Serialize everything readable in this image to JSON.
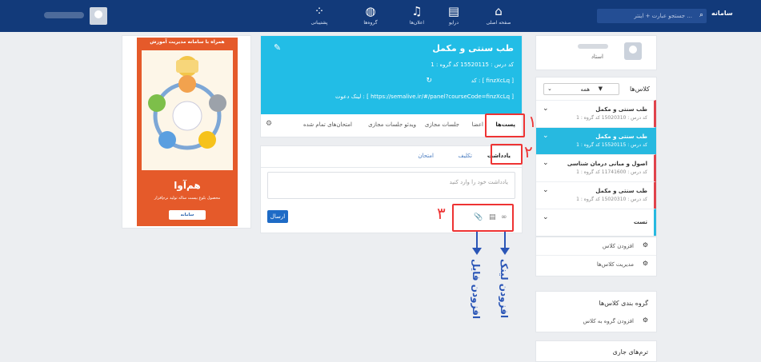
{
  "topbar": {
    "nav": [
      {
        "label": "صفحه اصلی",
        "icon": "home-icon"
      },
      {
        "label": "درایو",
        "icon": "drive-icon"
      },
      {
        "label": "اعلان‌ها",
        "icon": "bell-icon"
      },
      {
        "label": "گروه‌ها",
        "icon": "globe-icon"
      },
      {
        "label": "پشتیبانی",
        "icon": "rss-icon"
      }
    ],
    "search_placeholder": "جستجو عبارت + اینتر ...",
    "logo": "سامانه"
  },
  "profile": {
    "role": "استاد"
  },
  "classes": {
    "title": "کلاس‌ها",
    "filter_value": "همه",
    "items": [
      {
        "name": "طب سنتی و مکمل",
        "meta": "کد درس : 15020310    کد گروه : 1"
      },
      {
        "name": "طب سنتی و مکمل",
        "meta": "کد درس : 15520115    کد گروه : 1"
      },
      {
        "name": "اصول و مبانی درمان شناسی",
        "meta": "کد درس : 11741600    کد گروه : 1"
      },
      {
        "name": "طب سنتی و مکمل",
        "meta": "کد درس : 15020310    کد گروه : 1"
      },
      {
        "name": "تست",
        "meta": ""
      }
    ],
    "add_class": "افزودن کلاس",
    "manage_classes": "مدیریت کلاس‌ها"
  },
  "group": {
    "title": "گروه بندی کلاس‌ها",
    "add": "افزودن گروه به کلاس"
  },
  "terms": {
    "title": "ترم‌های جاری"
  },
  "course": {
    "title": "طب سنتی و مکمل",
    "code_line": "کد درس : 15520115    کد گروه : 1",
    "key_line": "کد : [ finzXcLq ]",
    "link_line": "لینک دعوت : [ https://semalive.ir/#/panel?courseCode=finzXcLq ]",
    "tabs": [
      "پست‌ها",
      "اعضا",
      "جلسات مجازی",
      "ویدئو جلسات مجازی",
      "امتحان‌های تمام شده"
    ]
  },
  "post": {
    "tabs": [
      "یادداشت",
      "تکلیف",
      "امتحان"
    ],
    "placeholder": "یادداشت خود را وارد کنید",
    "send": "ارسال"
  },
  "banner": {
    "header": "همراه با سامانه مدیریت آموزش",
    "title": "هم‌آوا",
    "subtitle": "محصول بلوغ بیست ساله تولید نرم‌افزار",
    "logo": "سامانه"
  },
  "annotations": {
    "n1": "۱",
    "n2": "۲",
    "n3": "۳",
    "add_file": "افزودن فایل",
    "add_link": "افزودن لینک"
  }
}
